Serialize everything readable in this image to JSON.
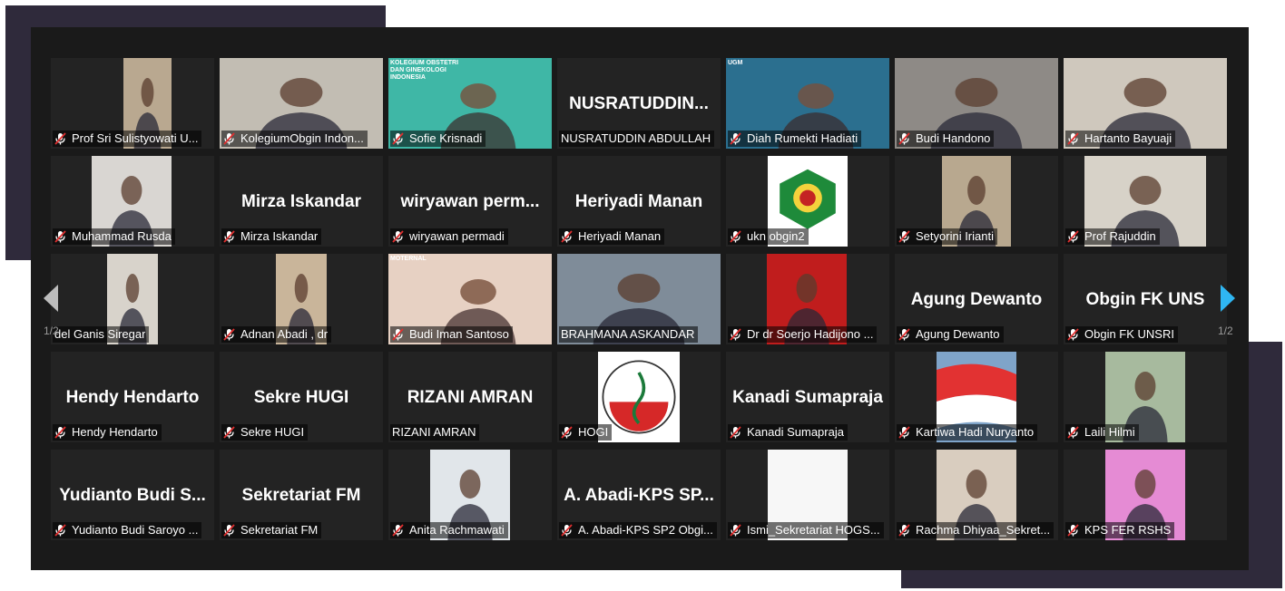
{
  "pagination": {
    "left": "1/2",
    "right": "1/2"
  },
  "tiles": [
    {
      "label": "Prof Sri  Sulistyowati U...",
      "muted": true,
      "type": "video",
      "bg": "#b9a890",
      "thumb": [
        80,
        133
      ]
    },
    {
      "label": "KolegiumObgin Indon...",
      "muted": true,
      "type": "video",
      "bg": "#c2bdb3",
      "thumb": [
        0,
        180
      ]
    },
    {
      "label": "Sofie Krisnadi",
      "muted": true,
      "type": "slide",
      "bg": "#3fb7a6",
      "thumb": [
        0,
        180
      ],
      "slide": "KOLEGIUM OBSTETRI DAN GINEKOLOGI INDONESIA"
    },
    {
      "label": "NUSRATUDDIN ABDULLAH",
      "muted": false,
      "type": "name",
      "name": "NUSRATUDDIN..."
    },
    {
      "label": "Diah Rumekti Hadiati",
      "muted": true,
      "type": "slide",
      "bg": "#2b6f8f",
      "thumb": [
        0,
        180
      ],
      "slide": "UGM"
    },
    {
      "label": "Budi Handono",
      "muted": true,
      "type": "video",
      "bg": "#8e8a86",
      "thumb": [
        0,
        180
      ]
    },
    {
      "label": "Hartanto Bayuaji",
      "muted": true,
      "type": "video",
      "bg": "#cfc8bd",
      "thumb": [
        0,
        180
      ]
    },
    {
      "label": "Muhammad Rusda",
      "muted": true,
      "type": "video",
      "bg": "#d9d6d2",
      "thumb": [
        45,
        133
      ]
    },
    {
      "label": "Mirza Iskandar",
      "muted": true,
      "type": "name",
      "name": "Mirza Iskandar"
    },
    {
      "label": "wiryawan permadi",
      "muted": true,
      "type": "name",
      "name": "wiryawan  perm..."
    },
    {
      "label": "Heriyadi Manan",
      "muted": true,
      "type": "name",
      "name": "Heriyadi Manan"
    },
    {
      "label": "ukn obgin2",
      "muted": true,
      "type": "logo",
      "bg": "#ffffff",
      "thumb": [
        46,
        134
      ]
    },
    {
      "label": "Setyorini Irianti",
      "muted": true,
      "type": "video",
      "bg": "#b8a88f",
      "thumb": [
        52,
        128
      ]
    },
    {
      "label": "Prof Rajuddin",
      "muted": true,
      "type": "video",
      "bg": "#d7d2c8",
      "thumb": [
        23,
        157
      ]
    },
    {
      "label": "del Ganis Siregar",
      "muted": false,
      "type": "video",
      "bg": "#d8d3cb",
      "thumb": [
        62,
        118
      ]
    },
    {
      "label": "Adnan Abadi , dr",
      "muted": true,
      "type": "video",
      "bg": "#c9b59a",
      "thumb": [
        62,
        118
      ]
    },
    {
      "label": "Budi Iman Santoso",
      "muted": true,
      "type": "slide",
      "bg": "#e7d1c3",
      "thumb": [
        0,
        180
      ],
      "slide": "MOTERNAL"
    },
    {
      "label": "BRAHMANA ASKANDAR",
      "muted": false,
      "type": "video",
      "bg": "#7f8c99",
      "thumb": [
        0,
        180
      ],
      "active": true
    },
    {
      "label": "Dr dr Soerjo Hadijono ...",
      "muted": true,
      "type": "video",
      "bg": "#c01d1d",
      "thumb": [
        45,
        133
      ]
    },
    {
      "label": "Agung Dewanto",
      "muted": true,
      "type": "name",
      "name": "Agung Dewanto"
    },
    {
      "label": "Obgin FK UNSRI",
      "muted": true,
      "type": "name",
      "name": "Obgin FK UNS"
    },
    {
      "label": "Hendy Hendarto",
      "muted": true,
      "type": "name",
      "name": "Hendy Hendarto"
    },
    {
      "label": "Sekre HUGI",
      "muted": true,
      "type": "name",
      "name": "Sekre HUGI"
    },
    {
      "label": "RIZANI AMRAN",
      "muted": false,
      "type": "name",
      "name": "RIZANI AMRAN"
    },
    {
      "label": "HOGI",
      "muted": true,
      "type": "logo2",
      "bg": "#ffffff",
      "thumb": [
        45,
        135
      ]
    },
    {
      "label": "Kanadi Sumapraja",
      "muted": true,
      "type": "name",
      "name": "Kanadi Sumapraja"
    },
    {
      "label": "Kartiwa Hadi Nuryanto",
      "muted": true,
      "type": "flag",
      "bg": "#7fa4c9",
      "thumb": [
        46,
        134
      ]
    },
    {
      "label": "Laili Hilmi",
      "muted": true,
      "type": "video",
      "bg": "#a7ba9e",
      "thumb": [
        46,
        134
      ]
    },
    {
      "label": "Yudianto Budi Saroyo ...",
      "muted": true,
      "type": "name",
      "name": "Yudianto  Budi S..."
    },
    {
      "label": "Sekretariat FM",
      "muted": true,
      "type": "name",
      "name": "Sekretariat FM"
    },
    {
      "label": "Anita Rachmawati",
      "muted": true,
      "type": "video",
      "bg": "#e1e6ea",
      "thumb": [
        46,
        134
      ]
    },
    {
      "label": "A. Abadi-KPS SP2 Obgi...",
      "muted": true,
      "type": "name",
      "name": "A. Abadi-KPS SP..."
    },
    {
      "label": "Ismi_Sekretariat HOGS...",
      "muted": true,
      "type": "blank",
      "bg": "#f7f7f7",
      "thumb": [
        46,
        134
      ]
    },
    {
      "label": "Rachma Dhiyaa_Sekret...",
      "muted": true,
      "type": "video",
      "bg": "#d9cdbf",
      "thumb": [
        46,
        134
      ]
    },
    {
      "label": "KPS FER RSHS",
      "muted": true,
      "type": "video",
      "bg": "#e58bd4",
      "thumb": [
        46,
        134
      ]
    }
  ]
}
